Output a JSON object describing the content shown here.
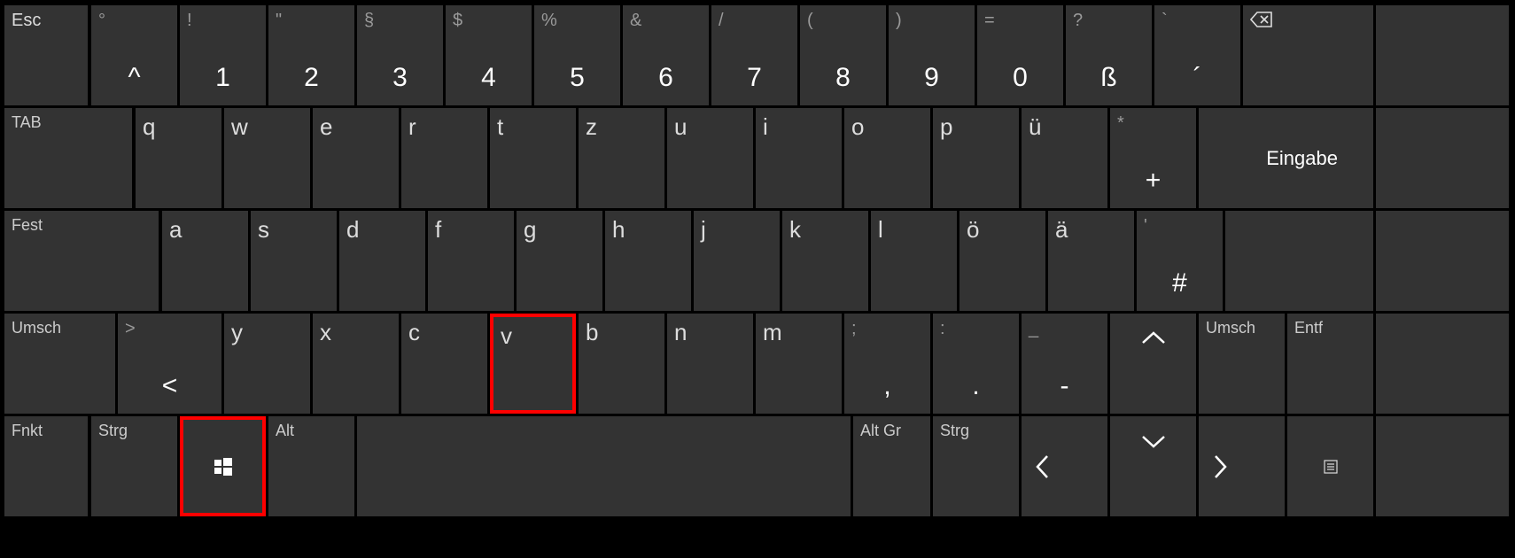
{
  "row1": {
    "esc": "Esc",
    "caret_top": "°",
    "caret_bottom": "^",
    "k1_top": "!",
    "k1_bottom": "1",
    "k2_top": "\"",
    "k2_bottom": "2",
    "k3_top": "§",
    "k3_bottom": "3",
    "k4_top": "$",
    "k4_bottom": "4",
    "k5_top": "%",
    "k5_bottom": "5",
    "k6_top": "&",
    "k6_bottom": "6",
    "k7_top": "/",
    "k7_bottom": "7",
    "k8_top": "(",
    "k8_bottom": "8",
    "k9_top": ")",
    "k9_bottom": "9",
    "k0_top": "=",
    "k0_bottom": "0",
    "ss_top": "?",
    "ss_bottom": "ß",
    "acc_top": "`",
    "acc_bottom": "´"
  },
  "row2": {
    "tab": "TAB",
    "q": "q",
    "w": "w",
    "e": "e",
    "r": "r",
    "t": "t",
    "z": "z",
    "u": "u",
    "i": "i",
    "o": "o",
    "p": "p",
    "ue": "ü",
    "plus_top": "*",
    "plus_bottom": "+",
    "enter": "Eingabe"
  },
  "row3": {
    "caps": "Fest",
    "a": "a",
    "s": "s",
    "d": "d",
    "f": "f",
    "g": "g",
    "h": "h",
    "j": "j",
    "k": "k",
    "l": "l",
    "oe": "ö",
    "ae": "ä",
    "hash_top": "'",
    "hash_bottom": "#"
  },
  "row4": {
    "shift_l": "Umsch",
    "lt_top": ">",
    "lt_bottom": "<",
    "y": "y",
    "x": "x",
    "c": "c",
    "v": "v",
    "b": "b",
    "n": "n",
    "m": "m",
    "comma_top": ";",
    "comma_bottom": ",",
    "period_top": ":",
    "period_bottom": ".",
    "dash_top": "_",
    "dash_bottom": "-",
    "caret": "^",
    "shift_r": "Umsch",
    "del": "Entf"
  },
  "row5": {
    "fn": "Fnkt",
    "ctrl_l": "Strg",
    "alt": "Alt",
    "altgr": "Alt Gr",
    "ctrl_r": "Strg",
    "left": "<",
    "down": "v",
    "right": ">"
  },
  "highlights": {
    "v_key": true,
    "win_key": true
  }
}
